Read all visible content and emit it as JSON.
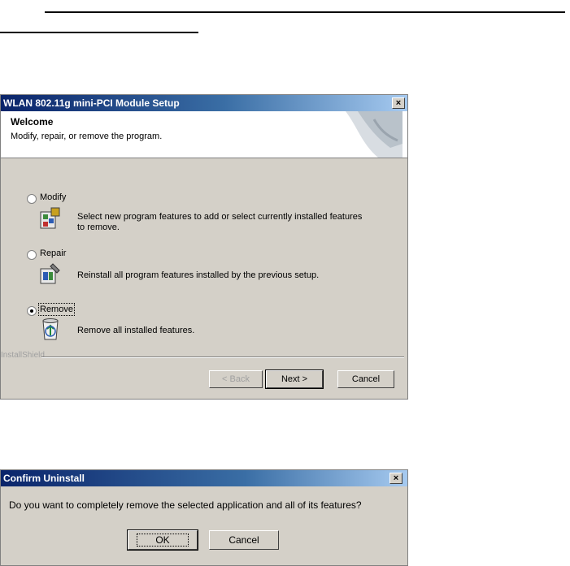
{
  "setup_dialog": {
    "title": "WLAN 802.11g mini-PCI Module Setup",
    "close": "×",
    "header_title": "Welcome",
    "header_subtitle": "Modify, repair, or remove the program.",
    "options": [
      {
        "label": "Modify",
        "selected": false,
        "description": "Select new program features to add or select currently installed features to remove."
      },
      {
        "label": "Repair",
        "selected": false,
        "description": "Reinstall all program features installed by the previous setup."
      },
      {
        "label": "Remove",
        "selected": true,
        "description": "Remove all installed features."
      }
    ],
    "brand": "InstallShield",
    "back_button": "< Back",
    "next_button": "Next >",
    "cancel_button": "Cancel"
  },
  "confirm_dialog": {
    "title": "Confirm Uninstall",
    "close": "×",
    "message": "Do you want to completely remove the selected application and all of its features?",
    "ok_button": "OK",
    "cancel_button": "Cancel"
  }
}
